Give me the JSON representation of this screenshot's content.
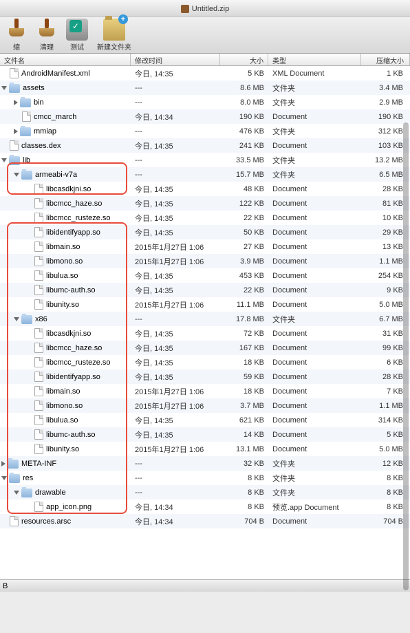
{
  "title": "Untitled.zip",
  "toolbar": {
    "shrink": "缩",
    "clean": "清理",
    "test": "测试",
    "newfolder": "新建文件夹"
  },
  "columns": {
    "name": "文件名",
    "mod": "修改时间",
    "size": "大小",
    "type": "类型",
    "csize": "压缩大小"
  },
  "rows": [
    {
      "indent": 1,
      "disc": "none",
      "icon": "file",
      "name": "AndroidManifest.xml",
      "mod": "今日, 14:35",
      "size": "5 KB",
      "type": "XML Document",
      "csize": "1 KB"
    },
    {
      "indent": 1,
      "disc": "down",
      "icon": "folder",
      "name": "assets",
      "mod": "---",
      "size": "8.6 MB",
      "type": "文件夹",
      "csize": "3.4 MB"
    },
    {
      "indent": 2,
      "disc": "right",
      "icon": "folder",
      "name": "bin",
      "mod": "---",
      "size": "8.0 MB",
      "type": "文件夹",
      "csize": "2.9 MB"
    },
    {
      "indent": 2,
      "disc": "none",
      "icon": "file",
      "name": "cmcc_march",
      "mod": "今日, 14:34",
      "size": "190 KB",
      "type": "Document",
      "csize": "190 KB"
    },
    {
      "indent": 2,
      "disc": "right",
      "icon": "folder",
      "name": "mmiap",
      "mod": "---",
      "size": "476 KB",
      "type": "文件夹",
      "csize": "312 KB"
    },
    {
      "indent": 1,
      "disc": "none",
      "icon": "file",
      "name": "classes.dex",
      "mod": "今日, 14:35",
      "size": "241 KB",
      "type": "Document",
      "csize": "103 KB"
    },
    {
      "indent": 1,
      "disc": "down",
      "icon": "folder",
      "name": "lib",
      "mod": "---",
      "size": "33.5 MB",
      "type": "文件夹",
      "csize": "13.2 MB"
    },
    {
      "indent": 2,
      "disc": "down",
      "icon": "folder",
      "name": "armeabi-v7a",
      "mod": "---",
      "size": "15.7 MB",
      "type": "文件夹",
      "csize": "6.5 MB"
    },
    {
      "indent": 3,
      "disc": "none",
      "icon": "file",
      "name": "libcasdkjni.so",
      "mod": "今日, 14:35",
      "size": "48 KB",
      "type": "Document",
      "csize": "28 KB"
    },
    {
      "indent": 3,
      "disc": "none",
      "icon": "file",
      "name": "libcmcc_haze.so",
      "mod": "今日, 14:35",
      "size": "122 KB",
      "type": "Document",
      "csize": "81 KB"
    },
    {
      "indent": 3,
      "disc": "none",
      "icon": "file",
      "name": "libcmcc_rusteze.so",
      "mod": "今日, 14:35",
      "size": "22 KB",
      "type": "Document",
      "csize": "10 KB"
    },
    {
      "indent": 3,
      "disc": "none",
      "icon": "file",
      "name": "libidentifyapp.so",
      "mod": "今日, 14:35",
      "size": "50 KB",
      "type": "Document",
      "csize": "29 KB"
    },
    {
      "indent": 3,
      "disc": "none",
      "icon": "file",
      "name": "libmain.so",
      "mod": "2015年1月27日 1:06",
      "size": "27 KB",
      "type": "Document",
      "csize": "13 KB"
    },
    {
      "indent": 3,
      "disc": "none",
      "icon": "file",
      "name": "libmono.so",
      "mod": "2015年1月27日 1:06",
      "size": "3.9 MB",
      "type": "Document",
      "csize": "1.1 MB"
    },
    {
      "indent": 3,
      "disc": "none",
      "icon": "file",
      "name": "libulua.so",
      "mod": "今日, 14:35",
      "size": "453 KB",
      "type": "Document",
      "csize": "254 KB"
    },
    {
      "indent": 3,
      "disc": "none",
      "icon": "file",
      "name": "libumc-auth.so",
      "mod": "今日, 14:35",
      "size": "22 KB",
      "type": "Document",
      "csize": "9 KB"
    },
    {
      "indent": 3,
      "disc": "none",
      "icon": "file",
      "name": "libunity.so",
      "mod": "2015年1月27日 1:06",
      "size": "11.1 MB",
      "type": "Document",
      "csize": "5.0 MB"
    },
    {
      "indent": 2,
      "disc": "down",
      "icon": "folder",
      "name": "x86",
      "mod": "---",
      "size": "17.8 MB",
      "type": "文件夹",
      "csize": "6.7 MB"
    },
    {
      "indent": 3,
      "disc": "none",
      "icon": "file",
      "name": "libcasdkjni.so",
      "mod": "今日, 14:35",
      "size": "72 KB",
      "type": "Document",
      "csize": "31 KB"
    },
    {
      "indent": 3,
      "disc": "none",
      "icon": "file",
      "name": "libcmcc_haze.so",
      "mod": "今日, 14:35",
      "size": "167 KB",
      "type": "Document",
      "csize": "99 KB"
    },
    {
      "indent": 3,
      "disc": "none",
      "icon": "file",
      "name": "libcmcc_rusteze.so",
      "mod": "今日, 14:35",
      "size": "18 KB",
      "type": "Document",
      "csize": "6 KB"
    },
    {
      "indent": 3,
      "disc": "none",
      "icon": "file",
      "name": "libidentifyapp.so",
      "mod": "今日, 14:35",
      "size": "59 KB",
      "type": "Document",
      "csize": "28 KB"
    },
    {
      "indent": 3,
      "disc": "none",
      "icon": "file",
      "name": "libmain.so",
      "mod": "2015年1月27日 1:06",
      "size": "18 KB",
      "type": "Document",
      "csize": "7 KB"
    },
    {
      "indent": 3,
      "disc": "none",
      "icon": "file",
      "name": "libmono.so",
      "mod": "2015年1月27日 1:06",
      "size": "3.7 MB",
      "type": "Document",
      "csize": "1.1 MB"
    },
    {
      "indent": 3,
      "disc": "none",
      "icon": "file",
      "name": "libulua.so",
      "mod": "今日, 14:35",
      "size": "621 KB",
      "type": "Document",
      "csize": "314 KB"
    },
    {
      "indent": 3,
      "disc": "none",
      "icon": "file",
      "name": "libumc-auth.so",
      "mod": "今日, 14:35",
      "size": "14 KB",
      "type": "Document",
      "csize": "5 KB"
    },
    {
      "indent": 3,
      "disc": "none",
      "icon": "file",
      "name": "libunity.so",
      "mod": "2015年1月27日 1:06",
      "size": "13.1 MB",
      "type": "Document",
      "csize": "5.0 MB"
    },
    {
      "indent": 1,
      "disc": "right",
      "icon": "folder",
      "name": "META-INF",
      "mod": "---",
      "size": "32 KB",
      "type": "文件夹",
      "csize": "12 KB"
    },
    {
      "indent": 1,
      "disc": "down",
      "icon": "folder",
      "name": "res",
      "mod": "---",
      "size": "8 KB",
      "type": "文件夹",
      "csize": "8 KB"
    },
    {
      "indent": 2,
      "disc": "down",
      "icon": "folder",
      "name": "drawable",
      "mod": "---",
      "size": "8 KB",
      "type": "文件夹",
      "csize": "8 KB"
    },
    {
      "indent": 3,
      "disc": "none",
      "icon": "file",
      "name": "app_icon.png",
      "mod": "今日, 14:34",
      "size": "8 KB",
      "type": "预览.app Document",
      "csize": "8 KB"
    },
    {
      "indent": 1,
      "disc": "none",
      "icon": "file",
      "name": "resources.arsc",
      "mod": "今日, 14:34",
      "size": "704 B",
      "type": "Document",
      "csize": "704 B"
    }
  ],
  "status": "B"
}
